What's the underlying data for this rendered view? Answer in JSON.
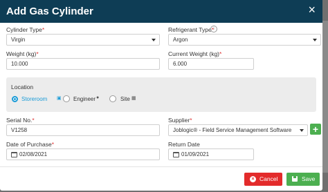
{
  "dialog": {
    "title": "Add Gas Cylinder",
    "close_glyph": "×"
  },
  "form": {
    "cylinder_type": {
      "label": "Cylinder Type",
      "required_mark": "*",
      "value": "Virgin"
    },
    "refrigerant_type": {
      "label": "Refrigerant Type",
      "required_mark": "*",
      "value": "Argon",
      "info_glyph": "i"
    },
    "weight": {
      "label": "Weight (kg)",
      "required_mark": "*",
      "value": "10.000"
    },
    "current_weight": {
      "label": "Current Weight (kg)",
      "required_mark": "*",
      "value": "6.000"
    },
    "location": {
      "label": "Location",
      "options": [
        {
          "label": "Storeroom",
          "selected": true,
          "icon": "storeroom-icon"
        },
        {
          "label": "Engineer",
          "selected": false,
          "icon": "person-icon"
        },
        {
          "label": "Site",
          "selected": false,
          "icon": "building-icon"
        }
      ]
    },
    "serial_no": {
      "label": "Serial No.",
      "required_mark": "*",
      "value": "V1258"
    },
    "supplier": {
      "label": "Supplier",
      "required_mark": "*",
      "value": "Joblogic® - Field Service Management Software",
      "add_glyph": "+"
    },
    "date_of_purchase": {
      "label": "Date of Purchase",
      "required_mark": "*",
      "value": "02/08/2021"
    },
    "return_date": {
      "label": "Return Date",
      "value": "01/09/2021"
    }
  },
  "actions": {
    "cancel_label": "Cancel",
    "save_label": "Save"
  },
  "colors": {
    "header": "#0e3d55",
    "accent": "#1a9bd7",
    "cancel": "#e32b2b",
    "save": "#4caf50"
  }
}
